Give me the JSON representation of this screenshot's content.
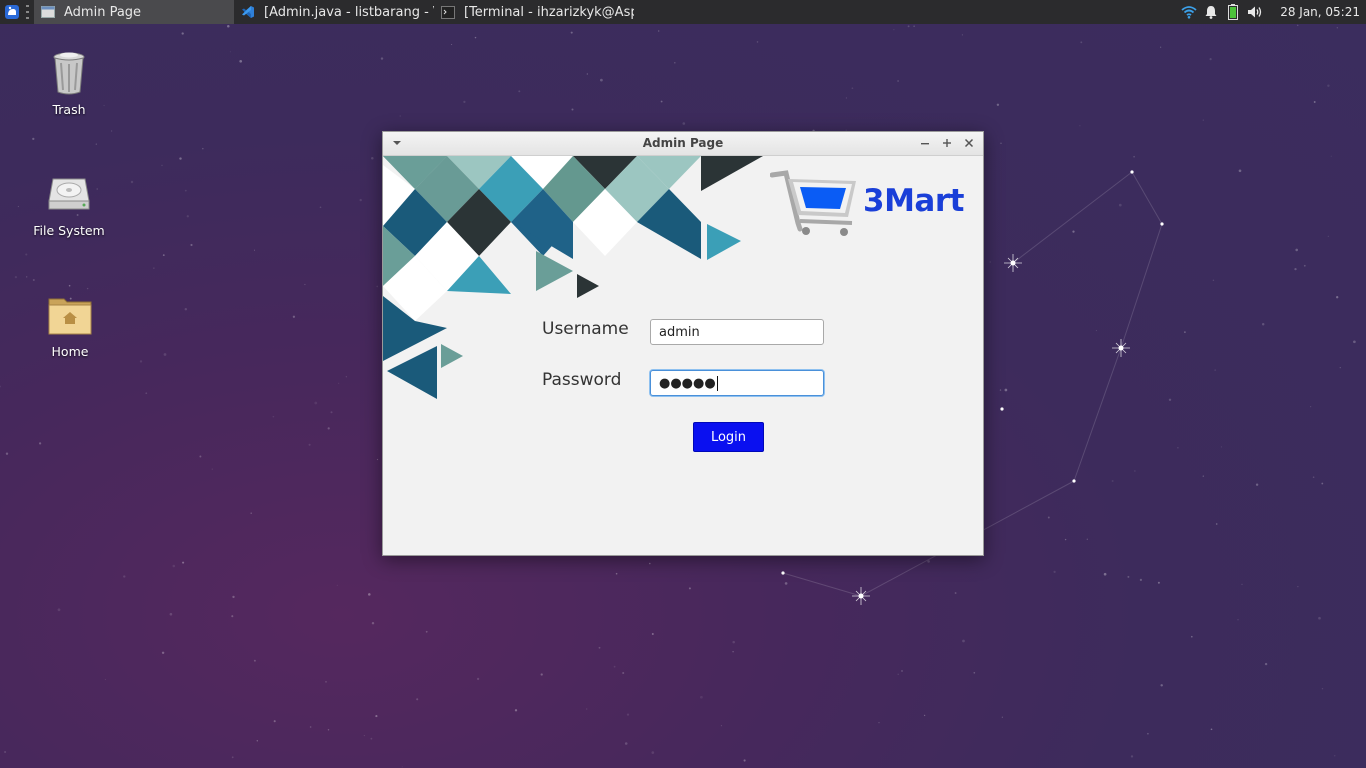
{
  "taskbar": {
    "tasks": [
      {
        "label": "Admin Page",
        "active": true
      },
      {
        "label": "[Admin.java - listbarang - Vis...",
        "active": false
      },
      {
        "label": "[Terminal - ihzarizkyk@Aspir...",
        "active": false
      }
    ],
    "clock": "28 Jan, 05:21",
    "tray_icons": [
      "wifi-icon",
      "bell-icon",
      "battery-icon",
      "volume-icon"
    ]
  },
  "desktop": {
    "icons": [
      {
        "label": "Trash",
        "icon": "trash-icon"
      },
      {
        "label": "File System",
        "icon": "drive-icon"
      },
      {
        "label": "Home",
        "icon": "home-folder-icon"
      }
    ]
  },
  "window": {
    "title": "Admin Page",
    "logo_text": "3Mart",
    "username_label": "Username",
    "username_value": "admin",
    "password_label": "Password",
    "password_value": "●●●●●",
    "login_label": "Login",
    "colors": {
      "accent": "#0a10f0",
      "logo": "#1a3fd8",
      "cart": "#0a5cf5"
    }
  }
}
